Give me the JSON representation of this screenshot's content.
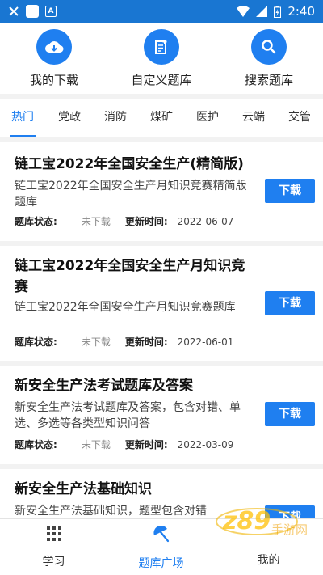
{
  "status_bar": {
    "time": "2:40"
  },
  "quick_actions": [
    {
      "label": "我的下载",
      "icon": "cloud-download-icon"
    },
    {
      "label": "自定义题库",
      "icon": "edit-document-icon"
    },
    {
      "label": "搜索题库",
      "icon": "search-icon"
    }
  ],
  "tabs": [
    "热门",
    "党政",
    "消防",
    "煤矿",
    "医护",
    "云端",
    "交管"
  ],
  "active_tab": "热门",
  "cards": [
    {
      "title": "链工宝2022年全国安全生产(精简版)",
      "desc": "链工宝2022年全国安全生产月知识竞赛精简版题库",
      "status_label": "题库状态:",
      "status_value": "未下载",
      "update_label": "更新时间:",
      "update_value": "2022-06-07",
      "button": "下载"
    },
    {
      "title": "链工宝2022年全国安全生产月知识竞赛",
      "desc": "链工宝2022年全国安全生产月知识竞赛题库",
      "status_label": "题库状态:",
      "status_value": "未下载",
      "update_label": "更新时间:",
      "update_value": "2022-06-01",
      "button": "下载"
    },
    {
      "title": "新安全生产法考试题库及答案",
      "desc": "新安全生产法考试题库及答案，包含对错、单选、多选等各类型知识问答",
      "status_label": "题库状态:",
      "status_value": "未下载",
      "update_label": "更新时间:",
      "update_value": "2022-03-09",
      "button": "下载"
    },
    {
      "title": "新安全生产法基础知识",
      "desc": "新安全生产法基础知识，题型包含对错",
      "button": "下载"
    }
  ],
  "bottom_nav": [
    {
      "label": "学习",
      "icon": "grid-icon"
    },
    {
      "label": "题库广场",
      "icon": "umbrella-icon"
    },
    {
      "label": "我的",
      "icon": "person-icon"
    }
  ],
  "active_bottom_nav": "题库广场",
  "colors": {
    "accent": "#1f7ff0",
    "status_bar": "#1976d2"
  }
}
